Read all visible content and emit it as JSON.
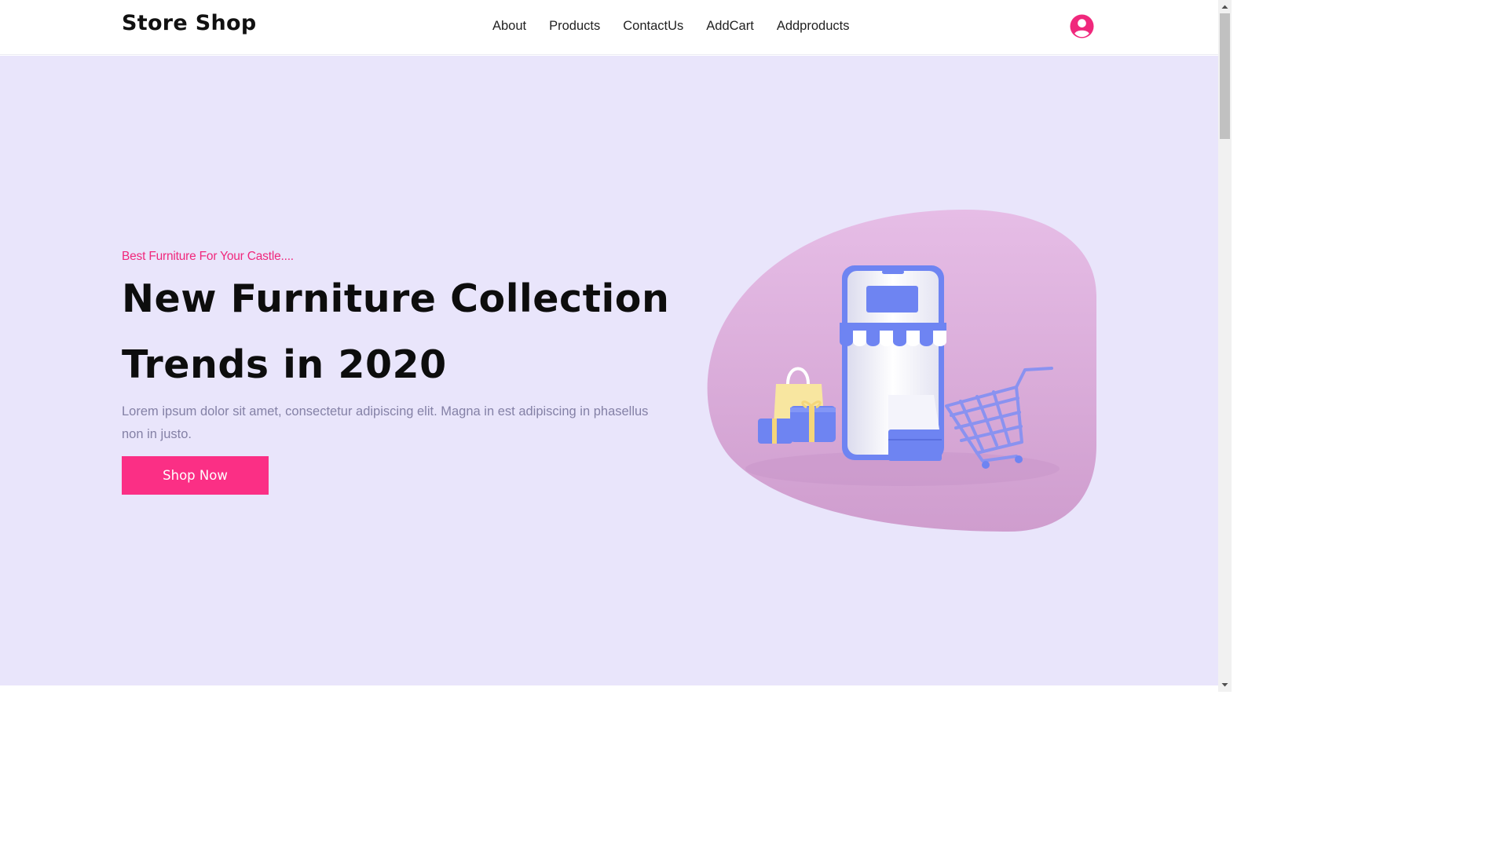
{
  "header": {
    "brand": "Store Shop",
    "nav": [
      "About",
      "Products",
      "ContactUs",
      "AddCart",
      "Addproducts"
    ],
    "avatar_icon": "user-circle-icon"
  },
  "hero": {
    "tagline": "Best Furniture For Your Castle....",
    "headline_line1": "New Furniture Collection",
    "headline_line2": "Trends in 2020",
    "description": "Lorem ipsum dolor sit amet, consectetur adipiscing elit. Magna in est adipiscing in phasellus non in justo.",
    "cta_label": "Shop Now",
    "illustration": "shop-phone-cart-illustration"
  },
  "colors": {
    "accent": "#fb2f85",
    "hero_bg": "#e9e5fb",
    "blob_bg": "#e2b9e4",
    "illustration_blue": "#6e84f2",
    "description_text": "#8481a6"
  }
}
